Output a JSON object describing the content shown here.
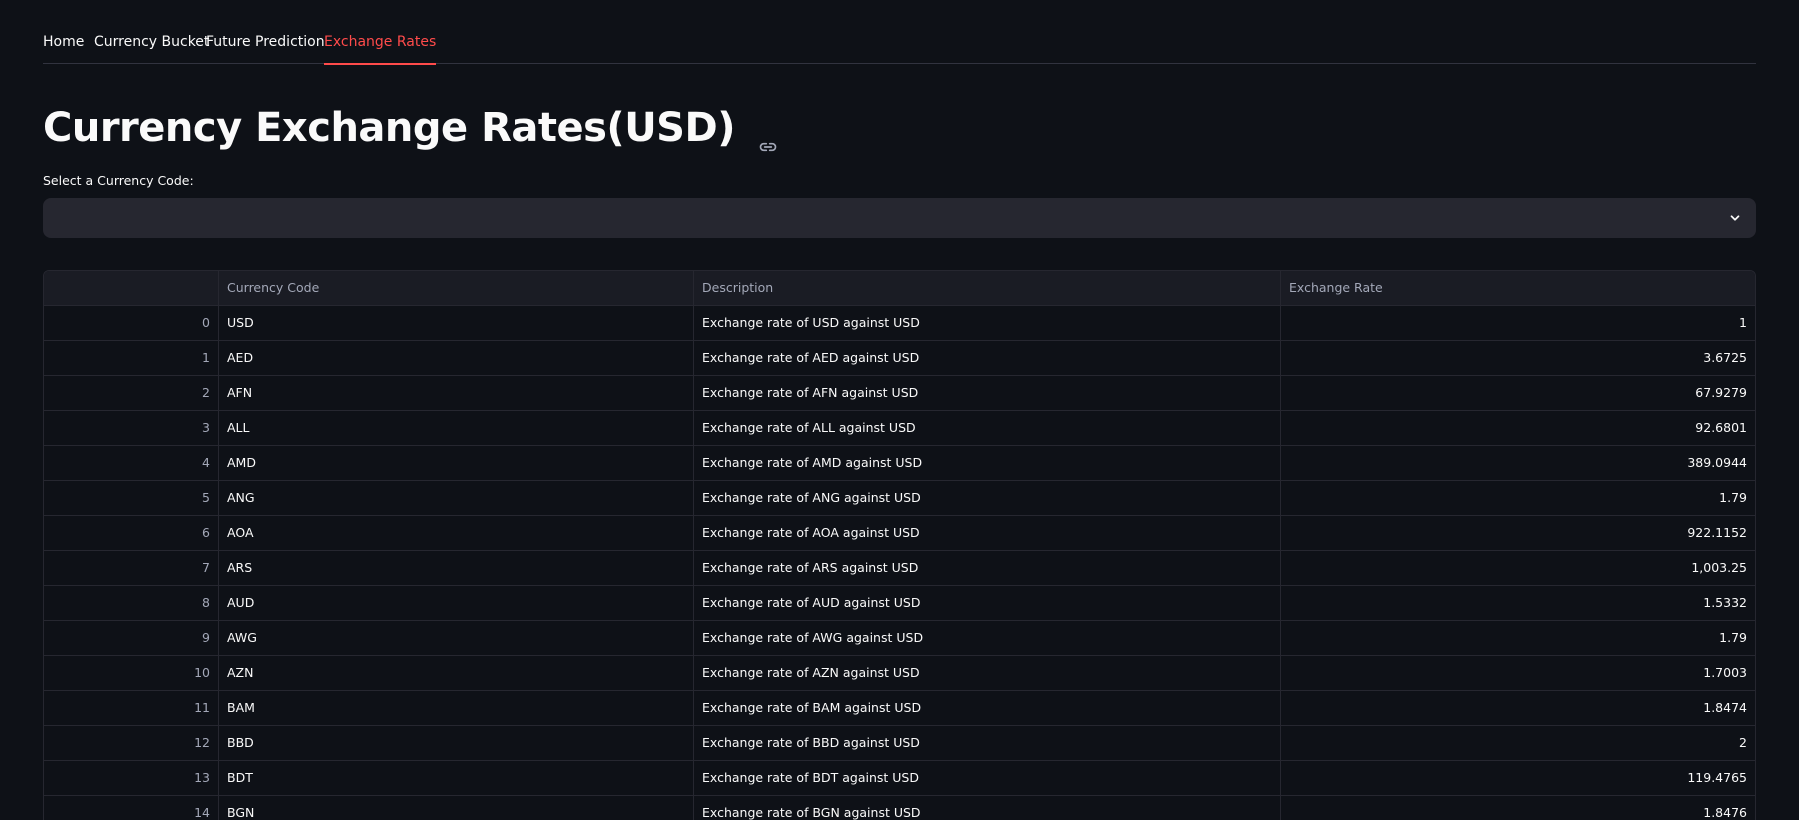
{
  "tabs": [
    {
      "label": "Home",
      "active": false
    },
    {
      "label": "Currency Bucket",
      "active": false
    },
    {
      "label": "Future Prediction",
      "active": false
    },
    {
      "label": "Exchange Rates",
      "active": true
    }
  ],
  "page_title": "Currency Exchange Rates(USD)",
  "title_icon": "link-icon",
  "select": {
    "label": "Select a Currency Code:",
    "value": "",
    "icon": "chevron-down-icon"
  },
  "table": {
    "columns": [
      "",
      "Currency Code",
      "Description",
      "Exchange Rate"
    ],
    "rows": [
      {
        "index": "0",
        "code": "USD",
        "description": "Exchange rate of USD against USD",
        "rate": "1"
      },
      {
        "index": "1",
        "code": "AED",
        "description": "Exchange rate of AED against USD",
        "rate": "3.6725"
      },
      {
        "index": "2",
        "code": "AFN",
        "description": "Exchange rate of AFN against USD",
        "rate": "67.9279"
      },
      {
        "index": "3",
        "code": "ALL",
        "description": "Exchange rate of ALL against USD",
        "rate": "92.6801"
      },
      {
        "index": "4",
        "code": "AMD",
        "description": "Exchange rate of AMD against USD",
        "rate": "389.0944"
      },
      {
        "index": "5",
        "code": "ANG",
        "description": "Exchange rate of ANG against USD",
        "rate": "1.79"
      },
      {
        "index": "6",
        "code": "AOA",
        "description": "Exchange rate of AOA against USD",
        "rate": "922.1152"
      },
      {
        "index": "7",
        "code": "ARS",
        "description": "Exchange rate of ARS against USD",
        "rate": "1,003.25"
      },
      {
        "index": "8",
        "code": "AUD",
        "description": "Exchange rate of AUD against USD",
        "rate": "1.5332"
      },
      {
        "index": "9",
        "code": "AWG",
        "description": "Exchange rate of AWG against USD",
        "rate": "1.79"
      },
      {
        "index": "10",
        "code": "AZN",
        "description": "Exchange rate of AZN against USD",
        "rate": "1.7003"
      },
      {
        "index": "11",
        "code": "BAM",
        "description": "Exchange rate of BAM against USD",
        "rate": "1.8474"
      },
      {
        "index": "12",
        "code": "BBD",
        "description": "Exchange rate of BBD against USD",
        "rate": "2"
      },
      {
        "index": "13",
        "code": "BDT",
        "description": "Exchange rate of BDT against USD",
        "rate": "119.4765"
      },
      {
        "index": "14",
        "code": "BGN",
        "description": "Exchange rate of BGN against USD",
        "rate": "1.8476"
      }
    ]
  },
  "colors": {
    "background": "#0e1117",
    "accent": "#ff4b4b",
    "select_bg": "#262730",
    "text": "#fafafa",
    "muted_text": "#a3a8b8"
  }
}
